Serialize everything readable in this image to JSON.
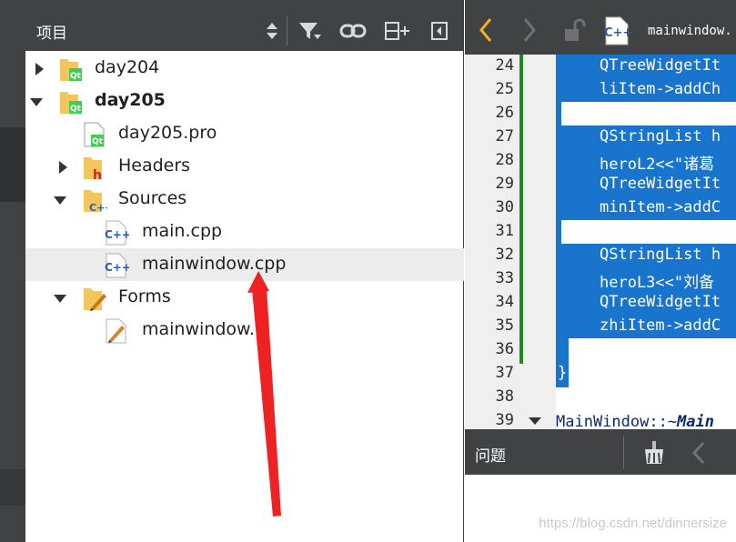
{
  "project_panel": {
    "title": "项目",
    "toolbar_icons": [
      "sort-icon",
      "filter-icon",
      "link-icon",
      "split-add-icon",
      "close-sidebar-icon"
    ],
    "tree": [
      {
        "label": "day204",
        "icon": "qt-folder-icon",
        "expanded": false,
        "bold": false
      },
      {
        "label": "day205",
        "icon": "qt-folder-icon",
        "expanded": true,
        "bold": true
      },
      {
        "label": "day205.pro",
        "icon": "qt-project-file-icon"
      },
      {
        "label": "Headers",
        "icon": "headers-folder-icon",
        "expanded": false
      },
      {
        "label": "Sources",
        "icon": "sources-folder-icon",
        "expanded": true
      },
      {
        "label": "main.cpp",
        "icon": "cpp-file-icon"
      },
      {
        "label": "mainwindow.cpp",
        "icon": "cpp-file-icon",
        "selected": true
      },
      {
        "label": "Forms",
        "icon": "forms-folder-icon",
        "expanded": true
      },
      {
        "label": "mainwindow.ui",
        "icon": "ui-file-icon"
      }
    ]
  },
  "editor": {
    "file_name": "mainwindow.",
    "file_icon": "cpp-file-icon",
    "nav_icons": [
      "back-arrow-icon",
      "forward-arrow-icon",
      "unlock-icon"
    ],
    "lines": [
      {
        "no": "24",
        "text": "QTreeWidgetIt",
        "selected": true
      },
      {
        "no": "25",
        "text": "liItem->addCh",
        "selected": true
      },
      {
        "no": "26",
        "text": "",
        "selected": true
      },
      {
        "no": "27",
        "text": "QStringList h",
        "selected": true
      },
      {
        "no": "28",
        "text": "heroL2<<\"诸葛",
        "selected": true
      },
      {
        "no": "29",
        "text": "QTreeWidgetIt",
        "selected": true
      },
      {
        "no": "30",
        "text": "minItem->addC",
        "selected": true
      },
      {
        "no": "31",
        "text": "",
        "selected": true
      },
      {
        "no": "32",
        "text": "QStringList h",
        "selected": true
      },
      {
        "no": "33",
        "text": "heroL3<<\"刘备",
        "selected": true
      },
      {
        "no": "34",
        "text": "QTreeWidgetIt",
        "selected": true
      },
      {
        "no": "35",
        "text": "zhiItem->addC",
        "selected": true
      },
      {
        "no": "36",
        "text": "",
        "selected": true
      },
      {
        "no": "37",
        "text": "}",
        "selected": true
      },
      {
        "no": "38",
        "text": "",
        "selected": false
      },
      {
        "no": "39",
        "text": "MainWindow::~",
        "kw": "Main",
        "selected": false
      }
    ]
  },
  "issues_pane": {
    "title": "问题",
    "icons": [
      "clean-icon",
      "back-arrow-icon"
    ]
  },
  "watermark": "https://blog.csdn.net/dinnersize",
  "colors": {
    "chrome_dark": "#404244",
    "selection": "#1874cd",
    "arrow_annotation": "#ee2222",
    "diff_marker": "#1d8a1d"
  }
}
